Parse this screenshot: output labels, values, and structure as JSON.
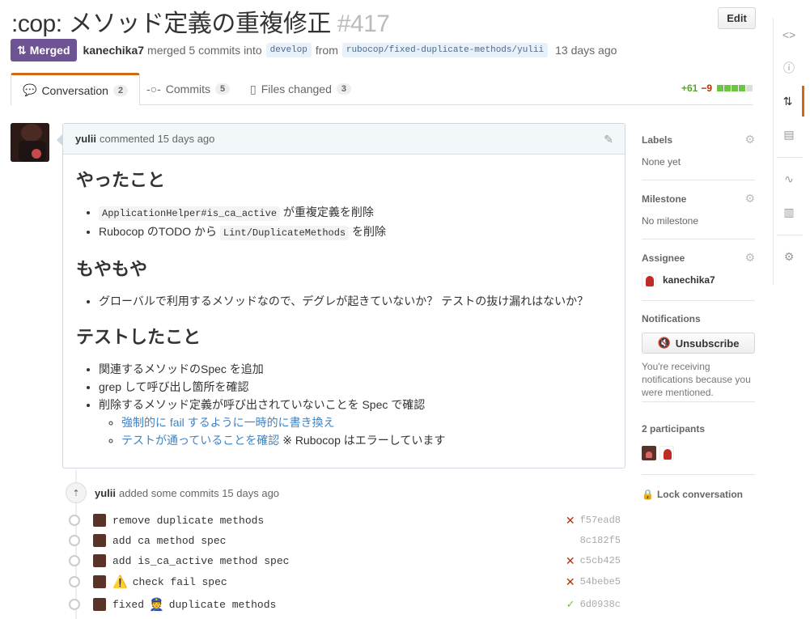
{
  "header": {
    "title": ":cop: メソッド定義の重複修正",
    "number": "#417",
    "edit_label": "Edit"
  },
  "meta": {
    "status": "Merged",
    "author": "kanechika7",
    "action": "merged 5 commits into",
    "base_branch": "develop",
    "from_label": "from",
    "head_branch": "rubocop/fixed-duplicate-methods/yulii",
    "time": "13 days ago"
  },
  "tabs": [
    {
      "label": "Conversation",
      "count": "2"
    },
    {
      "label": "Commits",
      "count": "5"
    },
    {
      "label": "Files changed",
      "count": "3"
    }
  ],
  "diffstat": {
    "additions": "+61",
    "deletions": "−9"
  },
  "comment": {
    "author": "yulii",
    "action": "commented",
    "time": "15 days ago",
    "h1": "やったこと",
    "done_1_code": "ApplicationHelper#is_ca_active",
    "done_1_text": "が重複定義を削除",
    "done_2_pre": "Rubocop のTODO から",
    "done_2_code": "Lint/DuplicateMethods",
    "done_2_text": "を削除",
    "h2": "もやもや",
    "concern_1": "グローバルで利用するメソッドなので、デグレが起きていないか？ テストの抜け漏れはないか？",
    "h3": "テストしたこと",
    "test_1": "関連するメソッドのSpec を追加",
    "test_2": "grep して呼び出し箇所を確認",
    "test_3": "削除するメソッド定義が呼び出されていないことを Spec で確認",
    "sub_1_link": "強制的に fail するように一時的に書き換え",
    "sub_2_link": "テストが通っていることを確認",
    "sub_2_note": "※ Rubocop はエラーしています"
  },
  "commits_event": {
    "author": "yulii",
    "action": "added some commits",
    "time": "15 days ago"
  },
  "commits": [
    {
      "msg": "remove duplicate methods",
      "sha": "f57ead8",
      "status": "fail"
    },
    {
      "msg": "add ca method spec",
      "sha": "8c182f5",
      "status": "none"
    },
    {
      "msg": "add is_ca_active method spec",
      "sha": "c5cb425",
      "status": "fail"
    },
    {
      "msg_pre": "⚠️",
      "msg": "check fail spec",
      "sha": "54bebe5",
      "status": "fail"
    },
    {
      "msg": "fixed",
      "msg_emoji": "👮",
      "msg_post": "duplicate methods",
      "sha": "6d0938c",
      "status": "success"
    }
  ],
  "sidebar": {
    "labels_title": "Labels",
    "labels_value": "None yet",
    "milestone_title": "Milestone",
    "milestone_value": "No milestone",
    "assignee_title": "Assignee",
    "assignee_value": "kanechika7",
    "notifications_title": "Notifications",
    "unsubscribe_label": "Unsubscribe",
    "notif_text": "You're receiving notifications because you were mentioned.",
    "participants_title": "2 participants",
    "lock_label": "Lock conversation"
  },
  "colors": {
    "merged": "#6e5494",
    "accent": "#d26911",
    "link": "#4183c4"
  }
}
